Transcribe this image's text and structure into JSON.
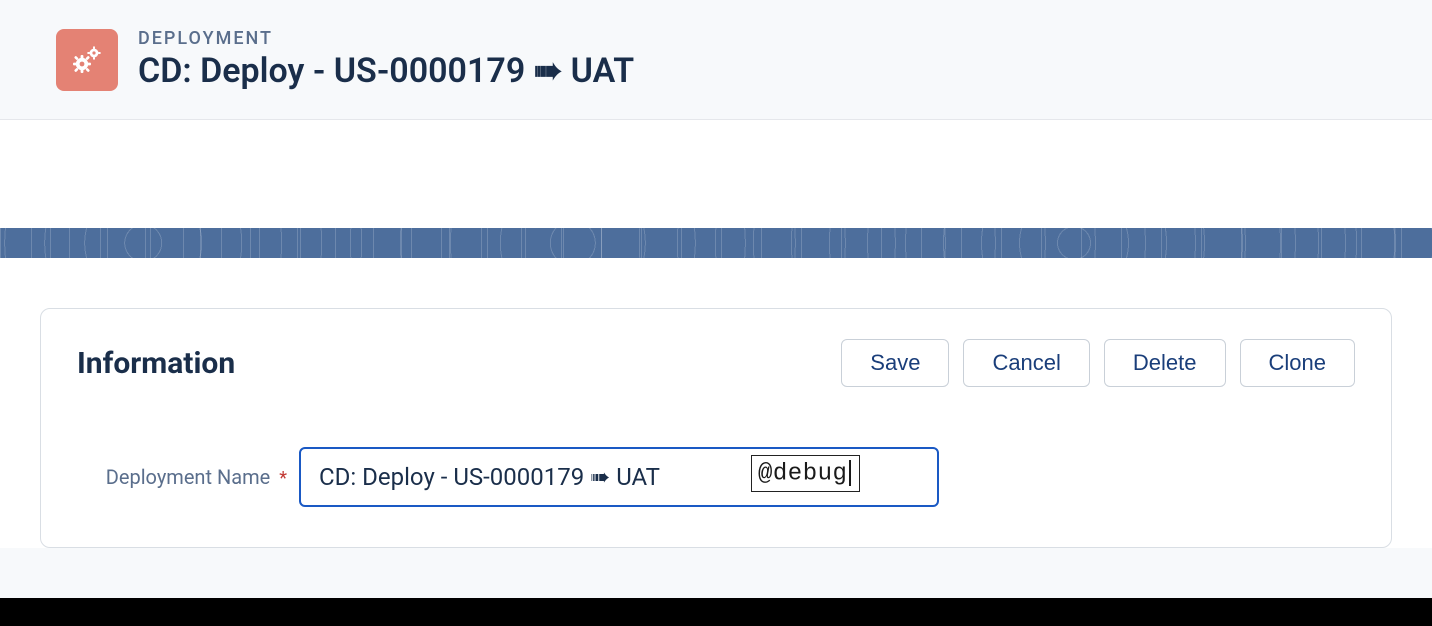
{
  "header": {
    "eyebrow": "DEPLOYMENT",
    "title": "CD: Deploy - US-0000179 ➠ UAT",
    "icon": "gears-icon"
  },
  "section": {
    "title": "Information"
  },
  "actions": {
    "save": "Save",
    "cancel": "Cancel",
    "delete": "Delete",
    "clone": "Clone"
  },
  "form": {
    "deployment_name": {
      "label": "Deployment Name",
      "required_mark": "*",
      "value": "CD: Deploy - US-0000179 ➠ UAT",
      "ime_text": "@debug"
    }
  }
}
